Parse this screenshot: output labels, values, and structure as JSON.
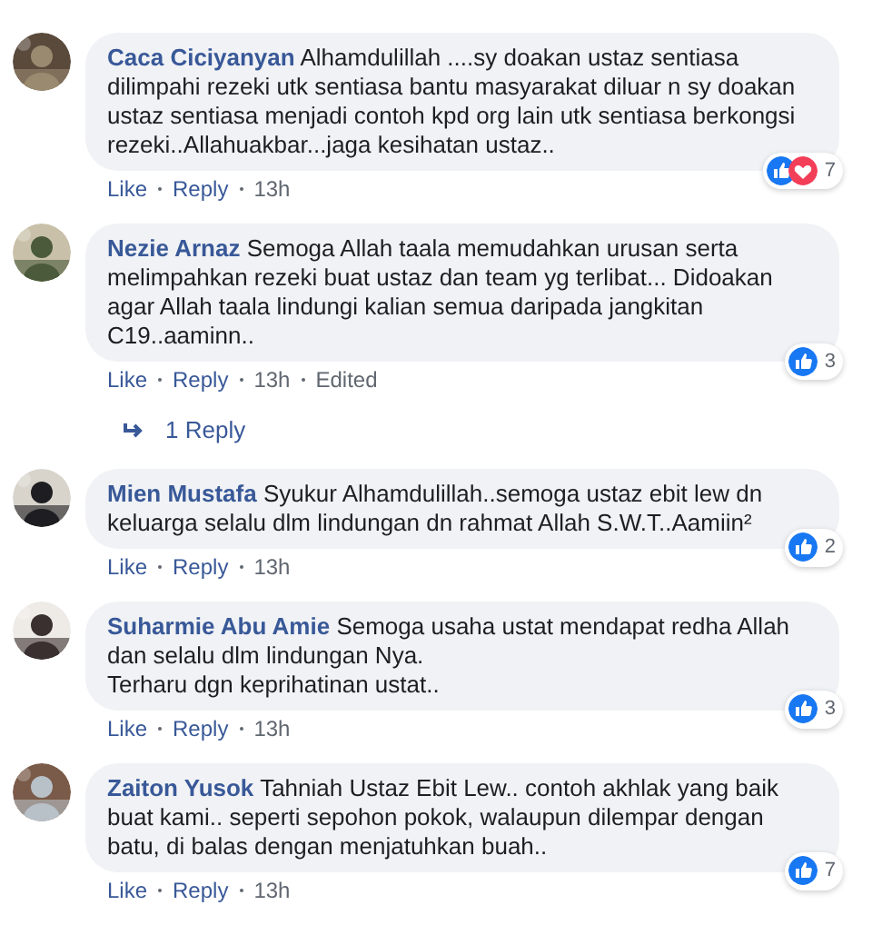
{
  "comments": [
    {
      "author": "Caca Ciciyanyan",
      "text": "Alhamdulillah ....sy doakan ustaz sentiasa dilimpahi rezeki utk sentiasa bantu masyarakat diluar n sy doakan ustaz sentiasa menjadi contoh kpd org lain utk sentiasa berkongsi rezeki..Allahuakbar...jaga kesihatan ustaz..",
      "like": "Like",
      "reply": "Reply",
      "time": "13h",
      "reactions": [
        {
          "kind": "like"
        },
        {
          "kind": "love"
        }
      ],
      "reaction_count": "7",
      "avatar": {
        "kind": "picture"
      }
    },
    {
      "author": "Nezie Arnaz",
      "text": "Semoga Allah taala memudahkan urusan serta melimpahkan rezeki buat ustaz dan team yg terlibat... Didoakan agar Allah taala lindungi kalian semua daripada jangkitan C19..aaminn..",
      "like": "Like",
      "reply": "Reply",
      "time": "13h",
      "edited": "Edited",
      "reactions": [
        {
          "kind": "like"
        }
      ],
      "reaction_count": "3",
      "replies_link": "1 Reply",
      "avatar": {
        "kind": "picture"
      }
    },
    {
      "author": "Mien Mustafa",
      "text": "Syukur Alhamdulillah..semoga ustaz ebit lew dn keluarga selalu dlm lindungan dn rahmat Allah S.W.T..Aamiin²",
      "like": "Like",
      "reply": "Reply",
      "time": "13h",
      "reactions": [
        {
          "kind": "like"
        }
      ],
      "reaction_count": "2",
      "avatar": {
        "kind": "picture"
      }
    },
    {
      "author": "Suharmie Abu Amie",
      "text": "Semoga usaha ustat mendapat redha Allah dan selalu dlm lindungan Nya.\nTerharu dgn keprihatinan ustat..",
      "like": "Like",
      "reply": "Reply",
      "time": "13h",
      "reactions": [
        {
          "kind": "like"
        }
      ],
      "reaction_count": "3",
      "avatar": {
        "kind": "picture"
      }
    },
    {
      "author": "Zaiton Yusok",
      "text": "Tahniah Ustaz Ebit Lew.. contoh akhlak yang baik buat kami.. seperti sepohon pokok, walaupun dilempar dengan batu, di balas dengan menjatuhkan buah..",
      "like": "Like",
      "reply": "Reply",
      "time": "13h",
      "reactions": [
        {
          "kind": "like"
        }
      ],
      "reaction_count": "7",
      "avatar": {
        "kind": "picture"
      }
    }
  ]
}
